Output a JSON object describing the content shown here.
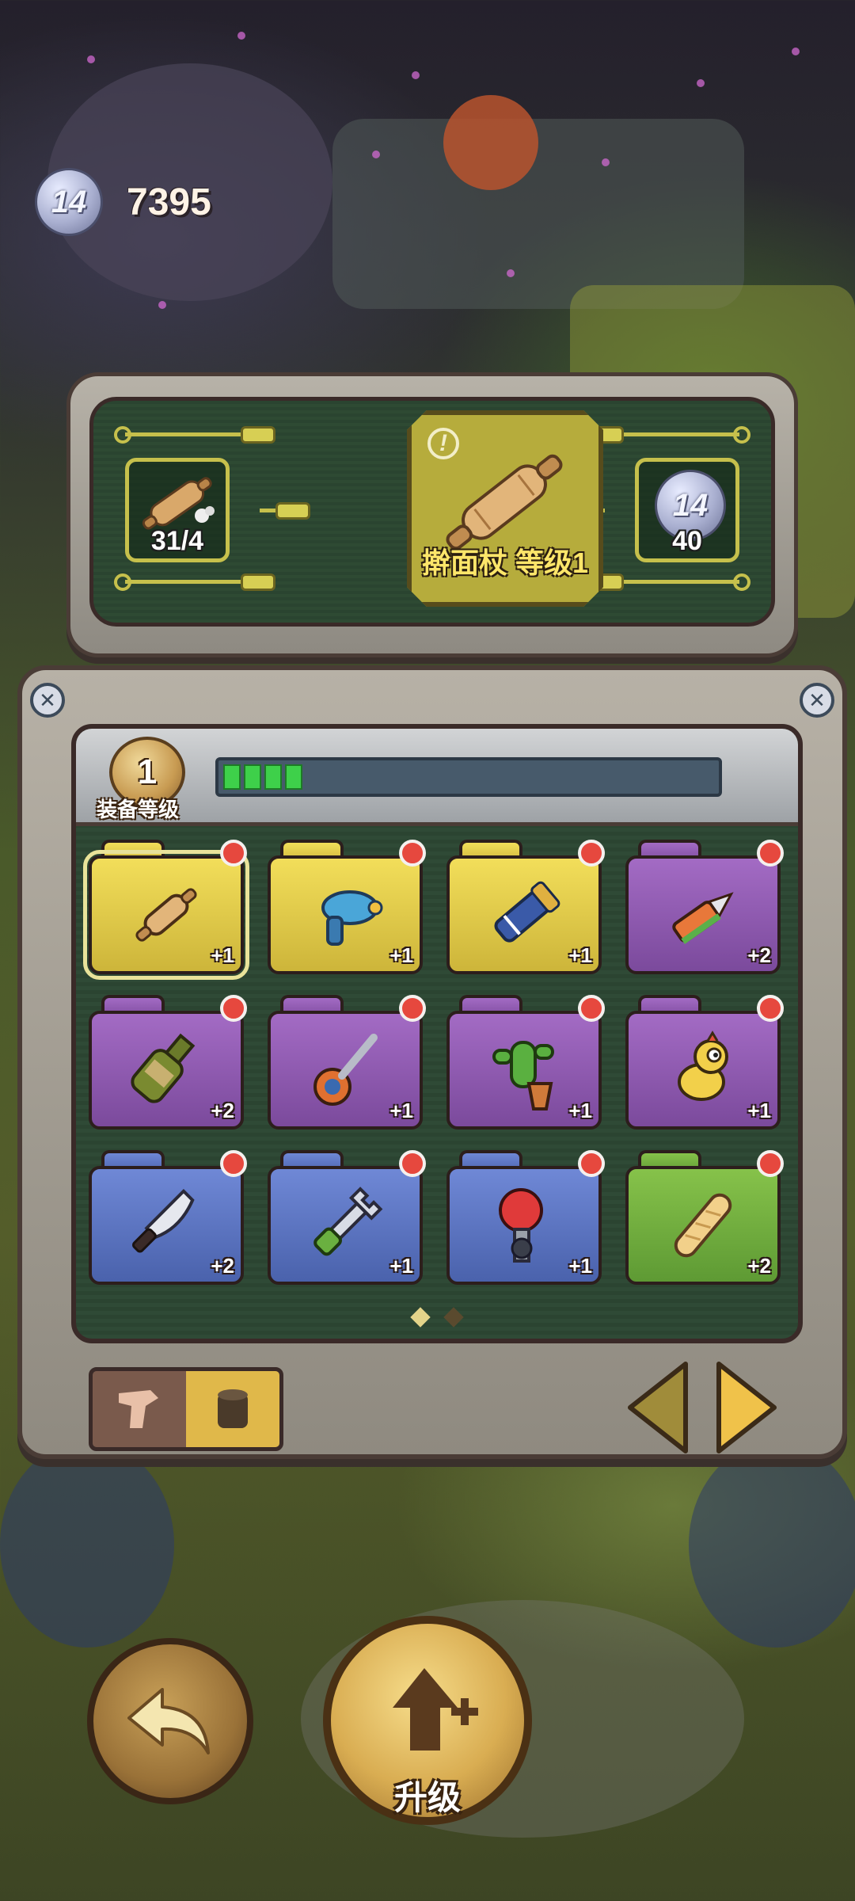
{
  "currency": {
    "icon": "rune-coin-icon",
    "coin_label": "14",
    "amount": "7395"
  },
  "upgrade_panel": {
    "material": {
      "icon": "rolling-pin-dust-icon",
      "count": "31/4"
    },
    "item": {
      "icon": "rolling-pin-icon",
      "name": "擀面杖 等级1",
      "info_icon": "!"
    },
    "cost": {
      "icon": "rune-coin-icon",
      "coin_label": "14",
      "amount": "40"
    }
  },
  "equipment_level": {
    "level": "1",
    "label": "装备等级",
    "progress_segments_filled": 4,
    "progress_fraction": 0.15
  },
  "inventory": [
    {
      "name": "rolling-pin",
      "color": "yellow",
      "bonus": "+1",
      "selected": true
    },
    {
      "name": "blue-raygun",
      "color": "yellow",
      "bonus": "+1",
      "selected": false
    },
    {
      "name": "gauntlet",
      "color": "yellow",
      "bonus": "+1",
      "selected": false
    },
    {
      "name": "box-cutter",
      "color": "purple",
      "bonus": "+2",
      "selected": false
    },
    {
      "name": "broken-bottle",
      "color": "purple",
      "bonus": "+2",
      "selected": false
    },
    {
      "name": "screwdriver",
      "color": "purple",
      "bonus": "+1",
      "selected": false
    },
    {
      "name": "cactus-pot",
      "color": "purple",
      "bonus": "+1",
      "selected": false
    },
    {
      "name": "rubber-chicken",
      "color": "purple",
      "bonus": "+1",
      "selected": false
    },
    {
      "name": "kitchen-knife",
      "color": "blue",
      "bonus": "+2",
      "selected": false
    },
    {
      "name": "wrench",
      "color": "blue",
      "bonus": "+1",
      "selected": false
    },
    {
      "name": "boxing-glove-robot",
      "color": "blue",
      "bonus": "+1",
      "selected": false
    },
    {
      "name": "baguette",
      "color": "green",
      "bonus": "+2",
      "selected": false
    }
  ],
  "pagination": {
    "pages": 2,
    "current": 1
  },
  "toggle": {
    "left_icon": "weapon-silhouette-icon",
    "right_icon": "canister-icon"
  },
  "buttons": {
    "upgrade_label": "升级",
    "back_icon": "back-arrow-icon",
    "upgrade_icon": "upgrade-arrow-icon"
  },
  "colors": {
    "yellow": "#e3cb4a",
    "purple": "#8d58b0",
    "blue": "#5a72c0",
    "green": "#72ae40",
    "progress": "#3ed04a"
  }
}
